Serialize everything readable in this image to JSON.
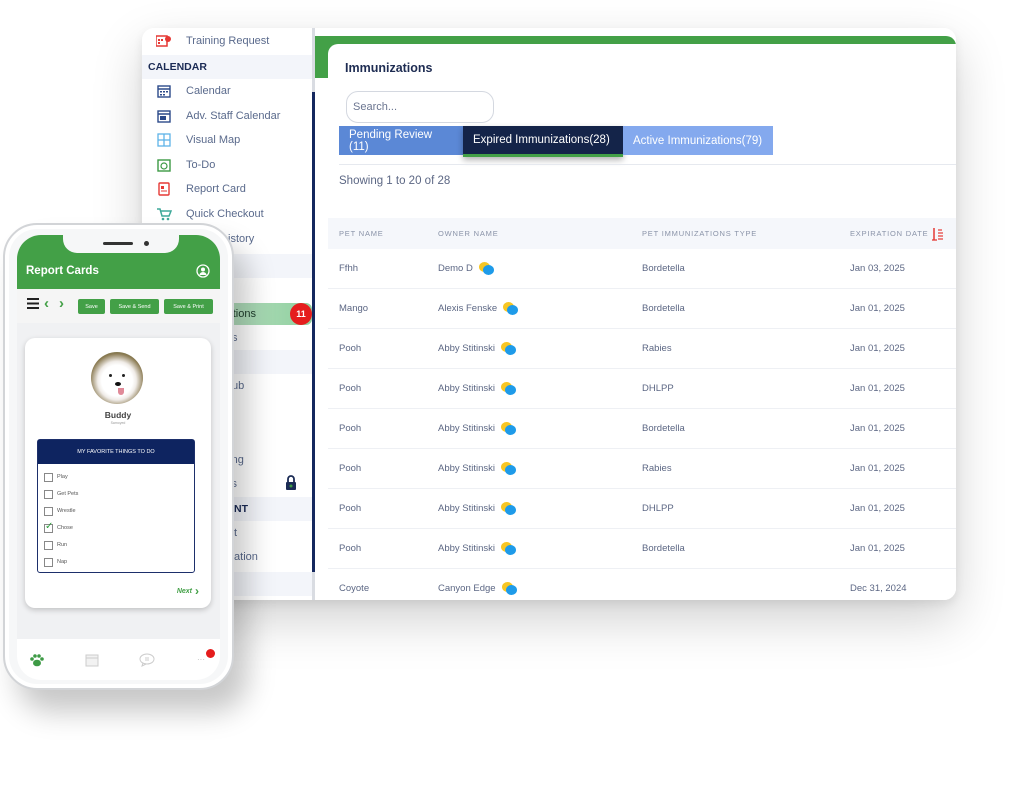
{
  "sidebar": {
    "items_top": [
      {
        "label": "Training Request",
        "icon": "training-request-icon"
      }
    ],
    "calendar_section": "CALENDAR",
    "calendar_items": [
      {
        "label": "Calendar",
        "icon": "calendar-icon"
      },
      {
        "label": "Adv. Staff Calendar",
        "icon": "staff-calendar-icon"
      },
      {
        "label": "Visual Map",
        "icon": "visual-map-icon"
      },
      {
        "label": "To-Do",
        "icon": "todo-icon"
      },
      {
        "label": "Report Card",
        "icon": "report-card-icon"
      },
      {
        "label": "Quick Checkout",
        "icon": "cart-icon"
      },
      {
        "label": "istory",
        "icon": "history-icon"
      }
    ],
    "active_item": {
      "label": "tions",
      "badge": "11"
    },
    "partial_items": [
      "s",
      "ub",
      "eting",
      "cs",
      "t",
      "culation"
    ],
    "partial_section": "NT",
    "colors": {
      "active_green": "#8fcf9e",
      "badge_red": "#e51d1d",
      "accent_navy": "#14275e"
    }
  },
  "main": {
    "title": "Immunizations",
    "search_placeholder": "Search...",
    "tabs": [
      {
        "label": "Pending Review (11)",
        "state": "default"
      },
      {
        "label": "Expired Immunizations(28)",
        "state": "selected"
      },
      {
        "label": "Active Immunizations(79)",
        "state": "default"
      }
    ],
    "showing": "Showing 1 to 20 of 28",
    "table": {
      "headers": [
        "PET NAME",
        "OWNER NAME",
        "PET IMMUNIZATIONS TYPE",
        "EXPIRATION DATE"
      ],
      "rows": [
        {
          "pet": "Ffhh",
          "owner": "Demo D",
          "type": "Bordetella",
          "date": "Jan 03, 2025"
        },
        {
          "pet": "Mango",
          "owner": "Alexis Fenske",
          "type": "Bordetella",
          "date": "Jan 01, 2025"
        },
        {
          "pet": "Pooh",
          "owner": "Abby Stitinski",
          "type": "Rabies",
          "date": "Jan 01, 2025"
        },
        {
          "pet": "Pooh",
          "owner": "Abby Stitinski",
          "type": "DHLPP",
          "date": "Jan 01, 2025"
        },
        {
          "pet": "Pooh",
          "owner": "Abby Stitinski",
          "type": "Bordetella",
          "date": "Jan 01, 2025"
        },
        {
          "pet": "Pooh",
          "owner": "Abby Stitinski",
          "type": "Rabies",
          "date": "Jan 01, 2025"
        },
        {
          "pet": "Pooh",
          "owner": "Abby Stitinski",
          "type": "DHLPP",
          "date": "Jan 01, 2025"
        },
        {
          "pet": "Pooh",
          "owner": "Abby Stitinski",
          "type": "Bordetella",
          "date": "Jan 01, 2025"
        },
        {
          "pet": "Coyote",
          "owner": "Canyon Edge",
          "type": "",
          "date": "Dec 31, 2024"
        }
      ]
    },
    "colors": {
      "brand_green": "#43a047",
      "tab_blue": "#5b88d6",
      "tab_dark": "#142449",
      "tab_light": "#84a9ee"
    }
  },
  "phone": {
    "title": "Report Cards",
    "buttons": {
      "save": "Save",
      "save_send": "Save & Send",
      "save_print": "Save & Print"
    },
    "pet_name": "Buddy",
    "pet_breed": "Samoyed",
    "favorites_title": "MY FAVORITE THINGS TO DO",
    "favorites": [
      {
        "label": "Play",
        "checked": false
      },
      {
        "label": "Get Pets",
        "checked": false
      },
      {
        "label": "Wrestle",
        "checked": false
      },
      {
        "label": "Chose",
        "checked": true
      },
      {
        "label": "Run",
        "checked": false
      },
      {
        "label": "Nap",
        "checked": false
      }
    ],
    "next_label": "Next",
    "tabbar": [
      "paw-icon",
      "calendar-icon",
      "chat-icon",
      "more-icon"
    ]
  }
}
